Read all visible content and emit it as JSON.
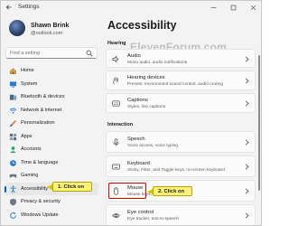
{
  "window": {
    "title": "Settings"
  },
  "profile": {
    "name": "Shawn Brink",
    "email": "@outlook.com"
  },
  "search": {
    "placeholder": "Find a setting"
  },
  "nav": {
    "items": [
      {
        "label": "Home",
        "icon": "home-icon"
      },
      {
        "label": "System",
        "icon": "system-icon"
      },
      {
        "label": "Bluetooth & devices",
        "icon": "bluetooth-icon"
      },
      {
        "label": "Network & internet",
        "icon": "network-icon"
      },
      {
        "label": "Personalization",
        "icon": "brush-icon"
      },
      {
        "label": "Apps",
        "icon": "apps-icon"
      },
      {
        "label": "Accounts",
        "icon": "accounts-icon"
      },
      {
        "label": "Time & language",
        "icon": "time-language-icon"
      },
      {
        "label": "Gaming",
        "icon": "gaming-icon"
      },
      {
        "label": "Accessibility",
        "icon": "accessibility-icon",
        "selected": true
      },
      {
        "label": "Privacy & security",
        "icon": "shield-icon"
      },
      {
        "label": "Windows Update",
        "icon": "update-icon"
      }
    ]
  },
  "page": {
    "title": "Accessibility",
    "watermark": "ElevenForum.com"
  },
  "sections": {
    "hearing": {
      "header": "Hearing",
      "cards": [
        {
          "title": "Audio",
          "desc": "Mono audio, audio notifications"
        },
        {
          "title": "Hearing devices",
          "desc": "Presets, environment sound control, audio routing"
        },
        {
          "title": "Captions",
          "desc": "Styles, live captions"
        }
      ]
    },
    "interaction": {
      "header": "Interaction",
      "cards": [
        {
          "title": "Speech",
          "desc": "Voice access, voice typing"
        },
        {
          "title": "Keyboard",
          "desc": "Sticky, Filter, and Toggle keys, on-screen keyboard"
        },
        {
          "title": "Mouse",
          "desc": "Mouse keys, speed, acceleration"
        },
        {
          "title": "Eye control",
          "desc": "Eye tracker, text-to-speech"
        }
      ]
    }
  },
  "callouts": {
    "step1": "1. Click on",
    "step2": "2. Click on"
  },
  "colors": {
    "accent": "#005fb8",
    "callout_fill": "#fff27a",
    "highlight": "#d10000"
  }
}
